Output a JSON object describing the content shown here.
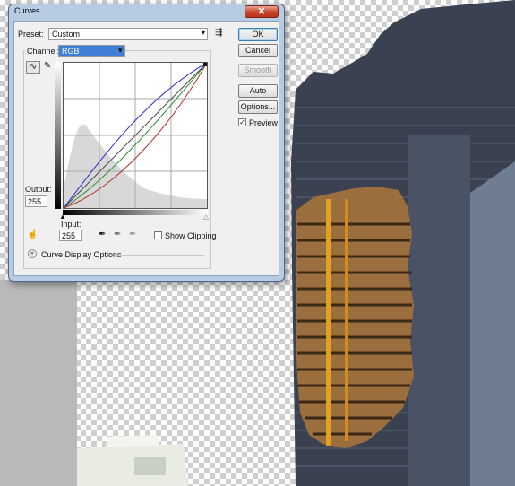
{
  "dialog": {
    "title": "Curves",
    "close_glyph": "✕",
    "preset": {
      "label": "Preset:",
      "value": "Custom"
    },
    "channel": {
      "label": "Channel:",
      "value": "RGB"
    },
    "output": {
      "label": "Output:",
      "value": "255"
    },
    "input": {
      "label": "Input:",
      "value": "255"
    },
    "show_clipping": {
      "label": "Show Clipping",
      "checked": false
    },
    "curve_display_options": "Curve Display Options",
    "buttons": {
      "ok": "OK",
      "cancel": "Cancel",
      "smooth": "Smooth",
      "auto": "Auto",
      "options": "Options..."
    },
    "preview": {
      "label": "Preview",
      "checked": true
    }
  },
  "icons": [
    "curve-point-icon",
    "pencil-icon",
    "preset-menu-icon",
    "target-adjust-icon",
    "black-eyedropper-icon",
    "gray-eyedropper-icon",
    "white-eyedropper-icon",
    "expand-chevron-icon"
  ],
  "colors": {
    "title_bar": "#b7cbe3",
    "channel_highlight": "#3f7fd8",
    "close_button": "#c6452a",
    "blue_curve": "#2a2ad0",
    "green_curve": "#2d8a2d",
    "red_curve": "#b03030"
  }
}
